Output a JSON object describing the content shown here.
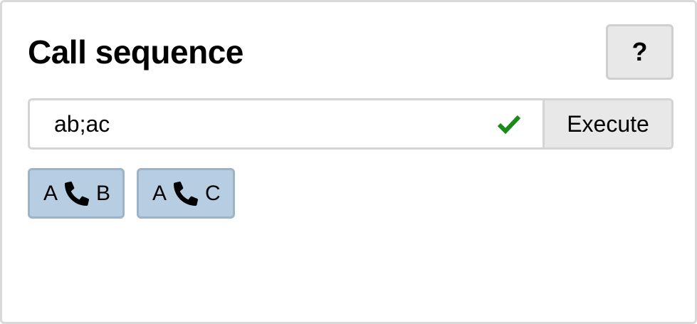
{
  "panel": {
    "title": "Call sequence",
    "help_label": "?"
  },
  "sequence": {
    "value": "ab;ac",
    "valid": true,
    "valid_icon": "check-icon",
    "valid_color": "#1a8a1a",
    "execute_label": "Execute"
  },
  "calls": [
    {
      "from": "A",
      "to": "B",
      "icon": "phone-icon"
    },
    {
      "from": "A",
      "to": "C",
      "icon": "phone-icon"
    }
  ],
  "colors": {
    "chip_background": "#b7cde2",
    "chip_border": "#9db3c6",
    "button_background": "#e8e8e8"
  }
}
